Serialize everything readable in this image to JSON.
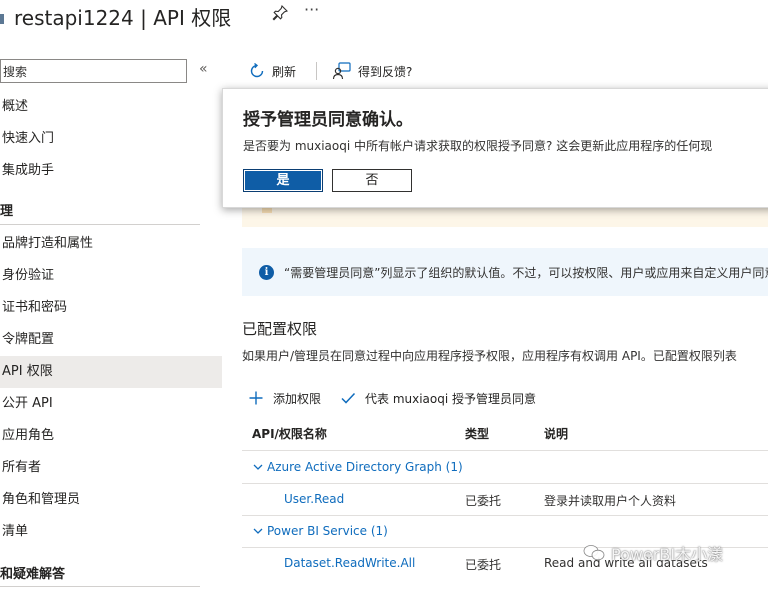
{
  "header": {
    "title": "restapi1224 | API 权限",
    "more": "···"
  },
  "sidebar": {
    "search_placeholder": "搜索",
    "collapse": "«",
    "items_top": [
      {
        "label": "概述"
      },
      {
        "label": "快速入门"
      },
      {
        "label": "集成助手"
      }
    ],
    "section_manage": "理",
    "items_manage": [
      {
        "label": "品牌打造和属性"
      },
      {
        "label": "身份验证"
      },
      {
        "label": "证书和密码"
      },
      {
        "label": "令牌配置"
      },
      {
        "label": "API 权限",
        "active": true
      },
      {
        "label": "公开 API"
      },
      {
        "label": "应用角色"
      },
      {
        "label": "所有者"
      },
      {
        "label": "角色和管理员"
      },
      {
        "label": "清单"
      }
    ],
    "section_support": "和疑难解答"
  },
  "toolbar": {
    "refresh": "刷新",
    "feedback": "得到反馈?"
  },
  "dialog": {
    "title": "授予管理员同意确认。",
    "message": "是否要为 muxiaoqi 中所有帐户请求获取的权限授予同意? 这会更新此应用程序的任何现",
    "yes": "是",
    "no": "否"
  },
  "info": {
    "text": "“需要管理员同意”列显示了组织的默认值。不过，可以按权限、用户或应用来自定义用户同意"
  },
  "configured": {
    "title": "已配置权限",
    "description": "如果用户/管理员在同意过程中向应用程序授予权限，应用程序有权调用 API。已配置权限列表",
    "add_permission": "添加权限",
    "grant_consent": "代表 muxiaoqi 授予管理员同意"
  },
  "table": {
    "headers": [
      "API/权限名称",
      "类型",
      "说明"
    ],
    "groups": [
      {
        "name": "Azure Active Directory Graph (1)",
        "rows": [
          {
            "name": "User.Read",
            "type": "已委托",
            "desc": "登录并读取用户个人资料"
          }
        ]
      },
      {
        "name": "Power BI Service (1)",
        "rows": [
          {
            "name": "Dataset.ReadWrite.All",
            "type": "已委托",
            "desc": "Read and write all datasets"
          }
        ]
      }
    ]
  },
  "watermark": "PowerBI木小漾",
  "colors": {
    "accent": "#0f5da6",
    "link": "#0f6cbd",
    "info_bg": "#eff6fc",
    "active_nav": "#edebe9"
  }
}
